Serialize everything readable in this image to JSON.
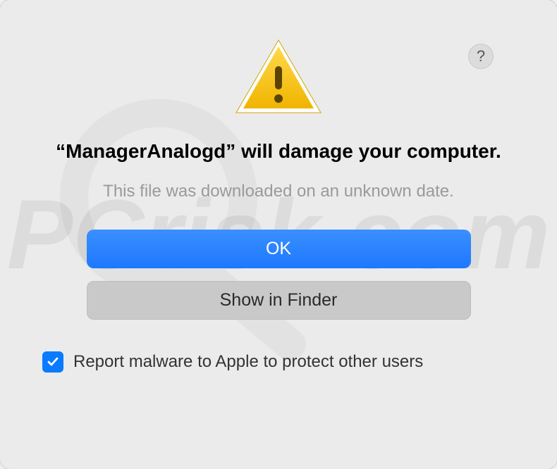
{
  "dialog": {
    "title": "“ManagerAnalogd” will damage your computer.",
    "subtitle": "This file was downloaded on an unknown date.",
    "primary_button": "OK",
    "secondary_button": "Show in Finder",
    "checkbox_label": "Report malware to Apple to protect other users",
    "checkbox_checked": true,
    "help_label": "?"
  },
  "icons": {
    "warning": "warning-triangle",
    "help": "question-circle",
    "checkmark": "checkmark"
  },
  "colors": {
    "primary_button": "#1e78ff",
    "secondary_button": "#c9c9c9",
    "checkbox": "#0a7aff",
    "warning_fill": "#f5c518",
    "background": "#ebebeb"
  }
}
